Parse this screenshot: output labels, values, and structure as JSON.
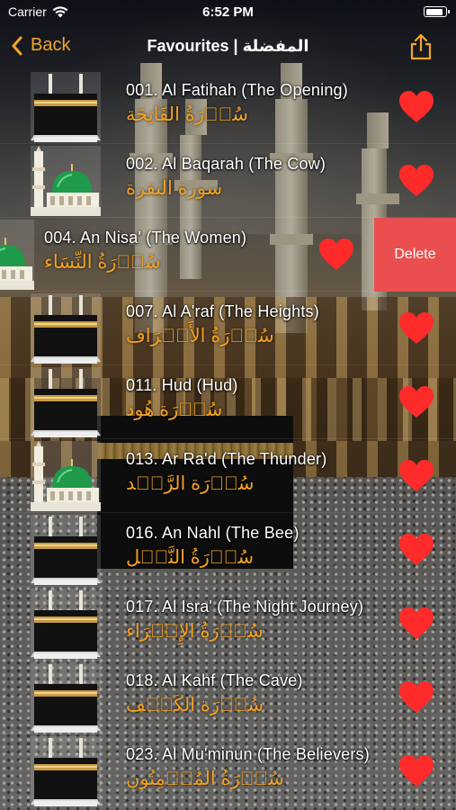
{
  "status_bar": {
    "carrier": "Carrier",
    "time": "6:52 PM",
    "battery_level": 0.9
  },
  "nav": {
    "back_label": "Back",
    "title": "Favourites | المفضلة",
    "share_icon": "share-icon"
  },
  "colors": {
    "accent": "#f4a62a",
    "arabic_text": "#f3a021",
    "heart": "#ff2a2a",
    "delete": "#ea4f4f"
  },
  "rows": [
    {
      "en": "001. Al Fatihah (The Opening)",
      "ar": "سُوۡرَةُ الفَاتِحَة",
      "thumb": "kaaba",
      "favourite": true
    },
    {
      "en": "002. Al Baqarah (The Cow)",
      "ar": "سورة البقرة",
      "thumb": "mosque",
      "favourite": true
    },
    {
      "en": "004. An Nisa' (The Women)",
      "ar": "سُوۡرَةُ النِّسَاء",
      "thumb": "mosque",
      "favourite": true,
      "swiped": true,
      "delete_label": "Delete"
    },
    {
      "en": "007. Al A'raf (The Heights)",
      "ar": "سُوۡرَةُ الأَعۡرَاف",
      "thumb": "kaaba",
      "favourite": true
    },
    {
      "en": "011. Hud (Hud)",
      "ar": "سُوۡرَة هُود",
      "thumb": "kaaba",
      "favourite": true
    },
    {
      "en": "013. Ar Ra'd (The Thunder)",
      "ar": "سُوۡرَة الرَّعۡد",
      "thumb": "mosque",
      "favourite": true
    },
    {
      "en": "016. An Nahl (The Bee)",
      "ar": "سُوۡرَةُ النَّحۡل",
      "thumb": "kaaba",
      "favourite": true
    },
    {
      "en": "017. Al Isra' (The Night Journey)",
      "ar": "سُوۡرَةُ الإِسۡرَاء",
      "thumb": "kaaba",
      "favourite": true
    },
    {
      "en": "018. Al Kahf (The Cave)",
      "ar": "سُوۡرَة الكَهۡف",
      "thumb": "kaaba",
      "favourite": true
    },
    {
      "en": "023. Al Mu'minun (The Believers)",
      "ar": "سُوۡرَةُ المُؤۡمِنُون",
      "thumb": "kaaba",
      "favourite": true
    }
  ]
}
